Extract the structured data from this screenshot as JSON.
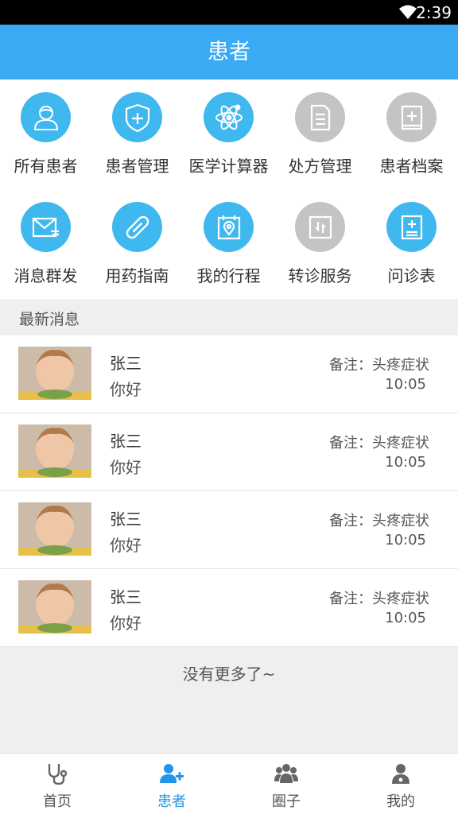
{
  "status_bar": {
    "time": "2:39",
    "wifi_icon": "wifi-icon"
  },
  "header": {
    "title": "患者"
  },
  "colors": {
    "accent": "#39aaf3",
    "icon_blue": "#3fb8ef",
    "icon_gray": "#c4c4c4",
    "tab_active": "#2196e8"
  },
  "grid": {
    "items": [
      {
        "label": "所有患者",
        "icon": "patients-icon",
        "color": "blue"
      },
      {
        "label": "患者管理",
        "icon": "shield-plus-icon",
        "color": "blue"
      },
      {
        "label": "医学计算器",
        "icon": "atom-icon",
        "color": "blue"
      },
      {
        "label": "处方管理",
        "icon": "document-icon",
        "color": "gray"
      },
      {
        "label": "患者档案",
        "icon": "medical-book-icon",
        "color": "gray"
      },
      {
        "label": "消息群发",
        "icon": "mail-icon",
        "color": "blue"
      },
      {
        "label": "用药指南",
        "icon": "pill-icon",
        "color": "blue"
      },
      {
        "label": "我的行程",
        "icon": "calendar-location-icon",
        "color": "blue"
      },
      {
        "label": "转诊服务",
        "icon": "transfer-icon",
        "color": "gray"
      },
      {
        "label": "问诊表",
        "icon": "clipboard-cross-icon",
        "color": "blue"
      }
    ]
  },
  "messages": {
    "section_title": "最新消息",
    "items": [
      {
        "name": "张三",
        "text": "你好",
        "note": "备注：头疼症状",
        "time": "10:05"
      },
      {
        "name": "张三",
        "text": "你好",
        "note": "备注：头疼症状",
        "time": "10:05"
      },
      {
        "name": "张三",
        "text": "你好",
        "note": "备注：头疼症状",
        "time": "10:05"
      },
      {
        "name": "张三",
        "text": "你好",
        "note": "备注：头疼症状",
        "time": "10:05"
      }
    ],
    "footer": "没有更多了~"
  },
  "tabbar": {
    "items": [
      {
        "label": "首页",
        "icon": "stethoscope-icon",
        "active": false
      },
      {
        "label": "患者",
        "icon": "add-user-icon",
        "active": true
      },
      {
        "label": "圈子",
        "icon": "group-icon",
        "active": false
      },
      {
        "label": "我的",
        "icon": "doctor-icon",
        "active": false
      }
    ]
  }
}
